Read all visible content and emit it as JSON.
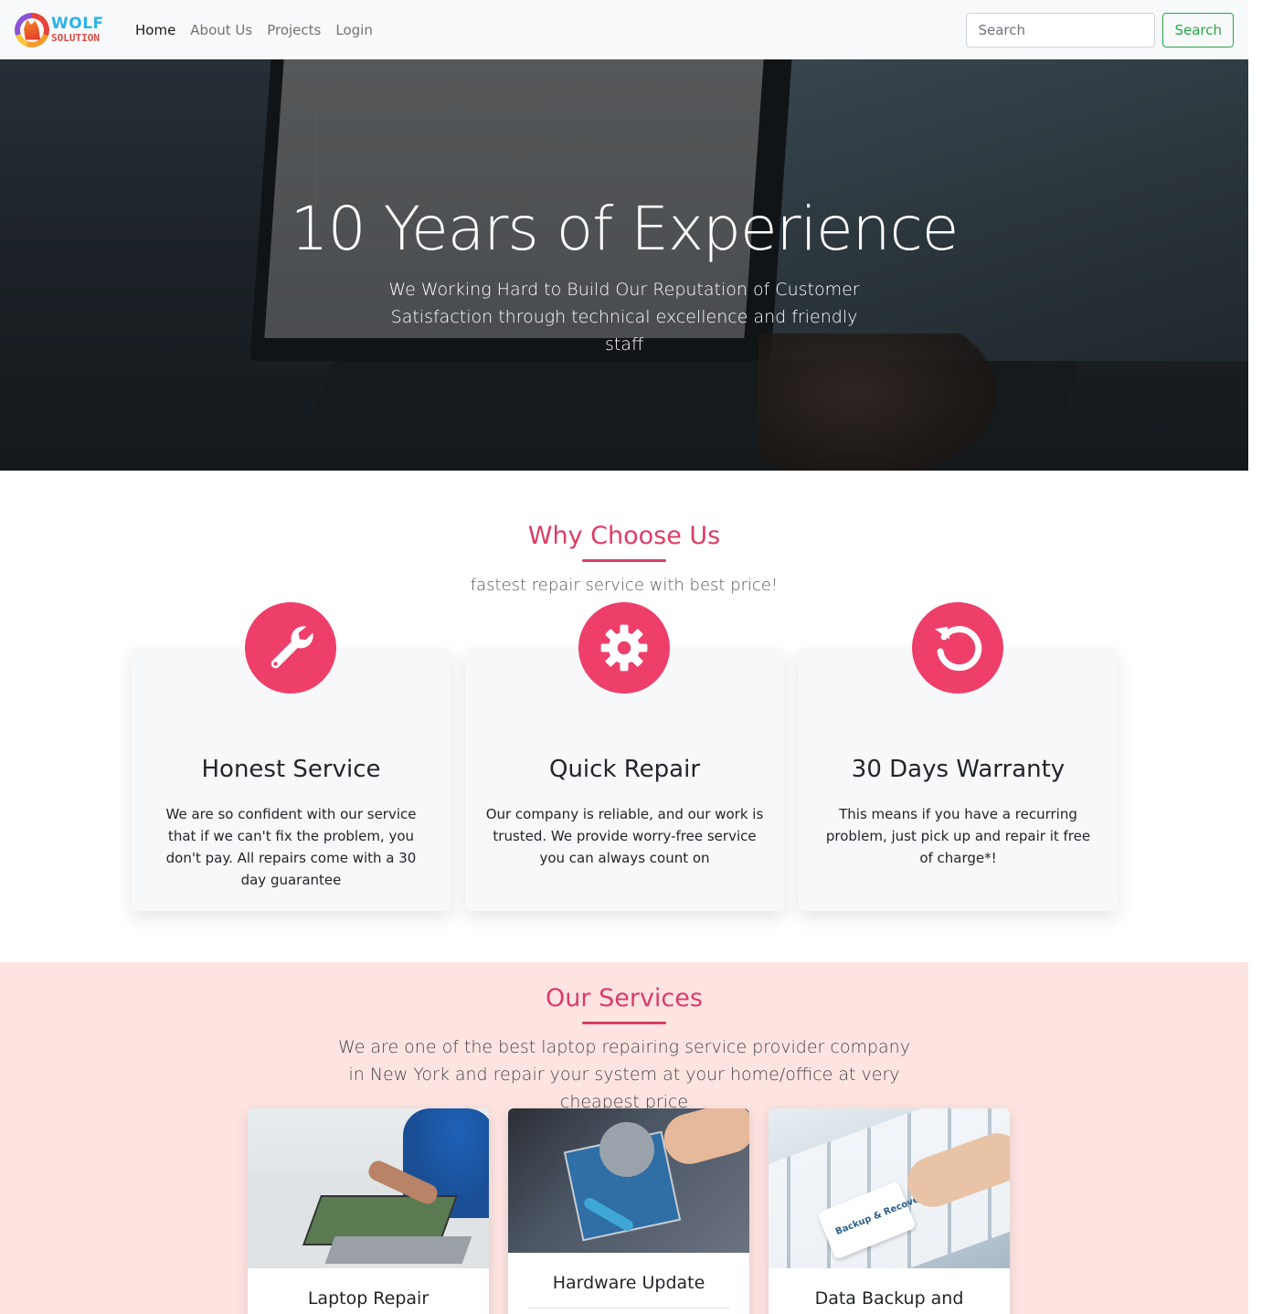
{
  "brand": {
    "line1": "WOLF",
    "line2": "SOLUTION"
  },
  "nav": {
    "links": [
      "Home",
      "About Us",
      "Projects",
      "Login"
    ],
    "active": "Home",
    "search_placeholder": "Search",
    "search_button": "Search"
  },
  "hero": {
    "title": "10 Years of Experience",
    "subtitle": "We Working Hard to Build Our Reputation of Customer Satisfaction through technical excellence and friendly staff"
  },
  "why": {
    "title": "Why Choose Us",
    "subtitle": "fastest repair service with best price!",
    "features": [
      {
        "icon": "wrench-icon",
        "title": "Honest Service",
        "text": "We are so confident with our service that if we can't fix the problem, you don't pay. All repairs come with a 30 day guarantee"
      },
      {
        "icon": "gear-icon",
        "title": "Quick Repair",
        "text": "Our company is reliable, and our work is trusted. We provide worry-free service you can always count on"
      },
      {
        "icon": "undo-icon",
        "title": "30 Days Warranty",
        "text": "This means if you have a recurring problem, just pick up and repair it free of charge*!"
      }
    ]
  },
  "services": {
    "title": "Our Services",
    "subtitle": "We are one of the best laptop repairing service provider company in New York and repair your system at your home/office at very cheapest price",
    "cards": [
      {
        "title": "Laptop Repair"
      },
      {
        "title": "Hardware Update"
      },
      {
        "title": "Data Backup and",
        "image_text": "Backup & Recovery"
      }
    ]
  },
  "colors": {
    "accent": "#dc3c64",
    "icon_bg": "#ee3f6a",
    "services_bg": "#fde4e1",
    "search_green": "#28a745"
  }
}
